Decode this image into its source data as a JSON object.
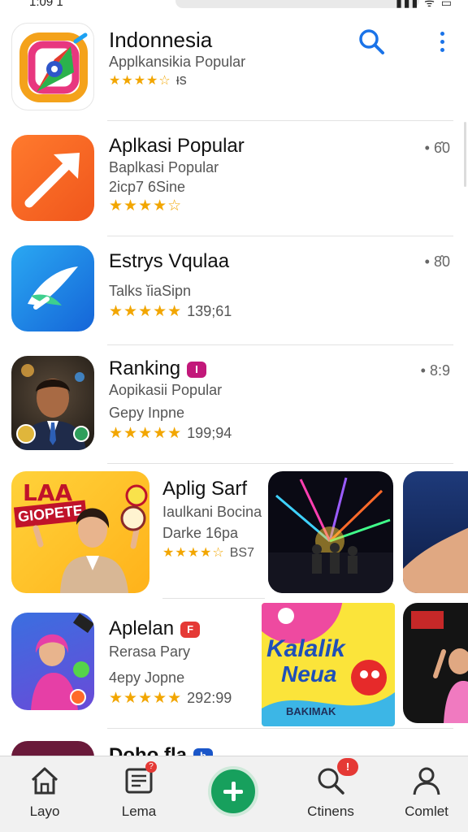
{
  "status": {
    "time": "1:09 1",
    "icons": "▮▮▮ ᯤ ▭"
  },
  "apps": [
    {
      "title": "Indonnesia",
      "subtitle": "Applkansikia Popular",
      "stars": "★★★★☆",
      "rating": "ᵻs",
      "meta": ""
    },
    {
      "title": "Aplkasi Popular",
      "subtitle": "Baplkasi Popular",
      "line2": "2icp7 6Sine",
      "stars": "★★★★☆",
      "meta": "• 6̂0"
    },
    {
      "title": "Estrys Vqulaa",
      "subtitle": "Talks ĭiaSipn",
      "stars": "★★★★★",
      "rating": "13̈9;61",
      "meta": "• 8̂0"
    },
    {
      "title": "Ranking",
      "badge": "I",
      "subtitle": "Aopikasii Popular",
      "line2": "Gepy Inpne",
      "stars": "★★★★★",
      "rating": "199;94",
      "meta": "• 8:9"
    },
    {
      "title": "Aplig Sarf",
      "subtitle": "Iaulkani Bocina",
      "line2": "Darke 16pa",
      "stars": "★★★★☆",
      "rating": "BS7",
      "meta": ""
    },
    {
      "title": "Aplelan",
      "badge": "F",
      "subtitle": "Rerasa Pary",
      "line2": "4epy Jopne",
      "stars": "★★★★★",
      "rating": "292:99",
      "meta": ""
    },
    {
      "title": "Doho fla",
      "badge": "b"
    }
  ],
  "posters": {
    "laa": {
      "line1": "LAA",
      "line2": "GIOPETE"
    },
    "kalalik": {
      "line1": "Kalalik",
      "line2": "Neua",
      "line3": "BAKIMAK"
    }
  },
  "nav": {
    "items": [
      {
        "label": "Layo"
      },
      {
        "label": "Lema"
      },
      {
        "label": ""
      },
      {
        "label": "Ctinens",
        "badge": "!"
      },
      {
        "label": "Comlet"
      }
    ]
  },
  "colors": {
    "accent": "#1a73e8",
    "star": "#f2a600",
    "fab": "#17a05d",
    "badge_red": "#e53935"
  }
}
